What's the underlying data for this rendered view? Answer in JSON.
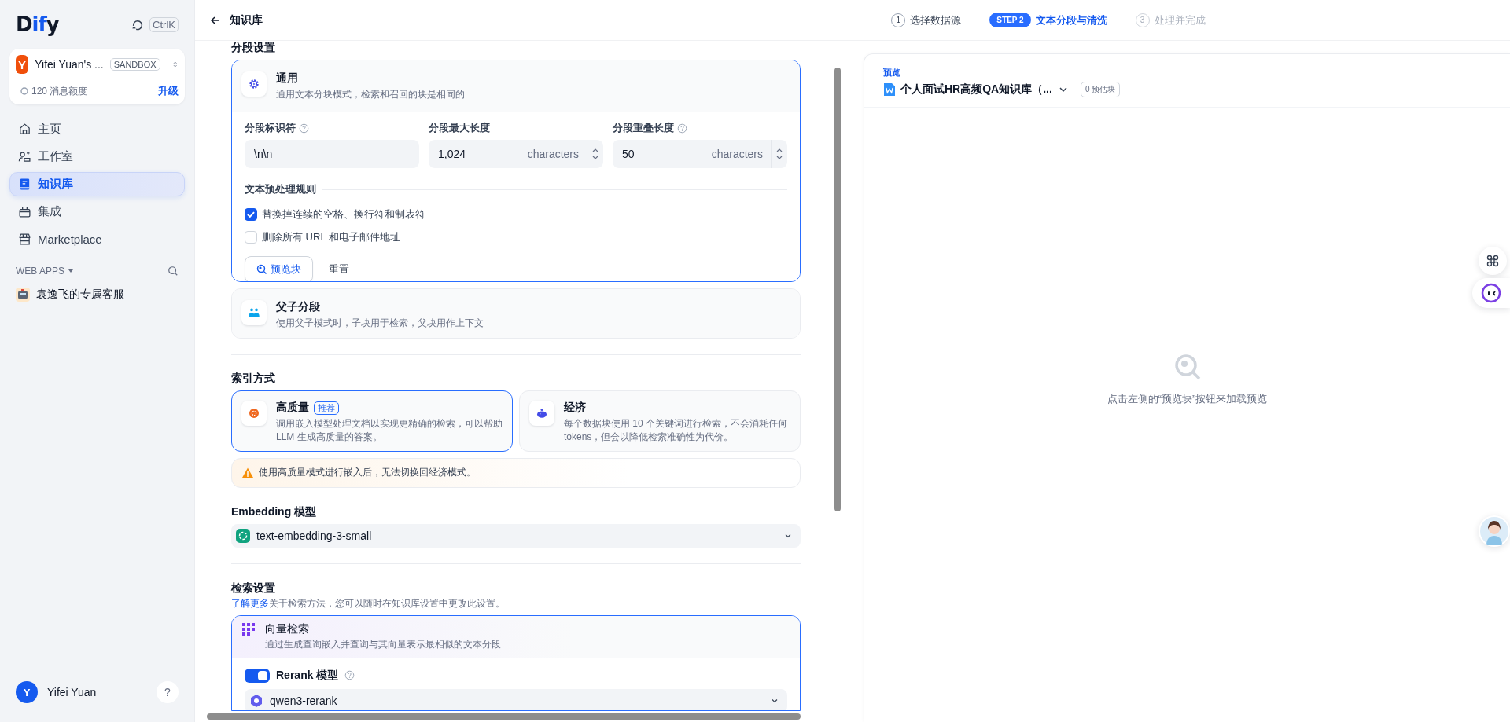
{
  "sidebar": {
    "logo": {
      "prefix": "D",
      "accent": "if",
      "suffix": "y"
    },
    "shortcut": "CtrlK",
    "workspace": {
      "avatar_letter": "Y",
      "name": "Yifei Yuan's ...",
      "plan": "SANDBOX",
      "credits": "120 消息额度",
      "upgrade": "升级"
    },
    "nav": [
      {
        "label": "主页",
        "selected": false
      },
      {
        "label": "工作室",
        "selected": false
      },
      {
        "label": "知识库",
        "selected": true
      },
      {
        "label": "集成",
        "selected": false
      },
      {
        "label": "Marketplace",
        "selected": false
      }
    ],
    "web_apps": {
      "title": "WEB APPS",
      "items": [
        {
          "label": "袁逸飞的专属客服"
        }
      ]
    },
    "user": {
      "avatar_letter": "Y",
      "name": "Yifei Yuan",
      "help": "?"
    }
  },
  "header": {
    "back_title": "知识库",
    "steps": [
      {
        "marker": "1",
        "label": "选择数据源",
        "selected": false,
        "disabled": false
      },
      {
        "marker": "STEP 2",
        "label": "文本分段与清洗",
        "selected": true,
        "disabled": false
      },
      {
        "marker": "3",
        "label": "处理并完成",
        "selected": false,
        "disabled": true
      }
    ]
  },
  "chunk_settings": {
    "title": "分段设置",
    "modes": [
      {
        "kind": "general",
        "title": "通用",
        "description": "通用文本分块模式，检索和召回的块是相同的",
        "selected": true,
        "fields": [
          {
            "label": "分段标识符",
            "help": true,
            "value": "\\n\\n"
          },
          {
            "label": "分段最大长度",
            "help": false,
            "value": "1,024",
            "unit": "characters"
          },
          {
            "label": "分段重叠长度",
            "help": true,
            "value": "50",
            "unit": "characters"
          }
        ],
        "rules_title": "文本预处理规则",
        "rules": [
          {
            "label": "替换掉连续的空格、换行符和制表符",
            "checked": true
          },
          {
            "label": "删除所有 URL 和电子邮件地址",
            "checked": false
          }
        ],
        "buttons": [
          {
            "label": "预览块",
            "kind": "outline"
          },
          {
            "label": "重置",
            "kind": "text"
          }
        ]
      },
      {
        "kind": "parent_child",
        "title": "父子分段",
        "description": "使用父子模式时，子块用于检索，父块用作上下文",
        "selected": false
      }
    ]
  },
  "index_method": {
    "title": "索引方式",
    "options": [
      {
        "kind": "high_quality",
        "title": "高质量",
        "badge": "推荐",
        "description": "调用嵌入模型处理文档以实现更精确的检索，可以帮助 LLM 生成高质量的答案。",
        "selected": true
      },
      {
        "kind": "economy",
        "title": "经济",
        "description": "每个数据块使用 10 个关键词进行检索，不会消耗任何 tokens，但会以降低检索准确性为代价。",
        "selected": false
      }
    ],
    "warning": "使用高质量模式进行嵌入后，无法切换回经济模式。"
  },
  "embedding": {
    "title": "Embedding 模型",
    "model": "text-embedding-3-small"
  },
  "retrieval": {
    "title": "检索设置",
    "link": "了解更多",
    "note": "关于检索方法，您可以随时在知识库设置中更改此设置。",
    "methods": [
      {
        "kind": "vector",
        "title": "向量检索",
        "description": "通过生成查询嵌入并查询与其向量表示最相似的文本分段",
        "selected": true,
        "rerank": {
          "label": "Rerank 模型",
          "on": true,
          "model": "qwen3-rerank"
        }
      }
    ]
  },
  "preview": {
    "label": "预览",
    "document": "个人面试HR高频QA知识库（...",
    "count": "0 预估块",
    "empty_hint": "点击左侧的“预览块”按钮来加载预览"
  }
}
